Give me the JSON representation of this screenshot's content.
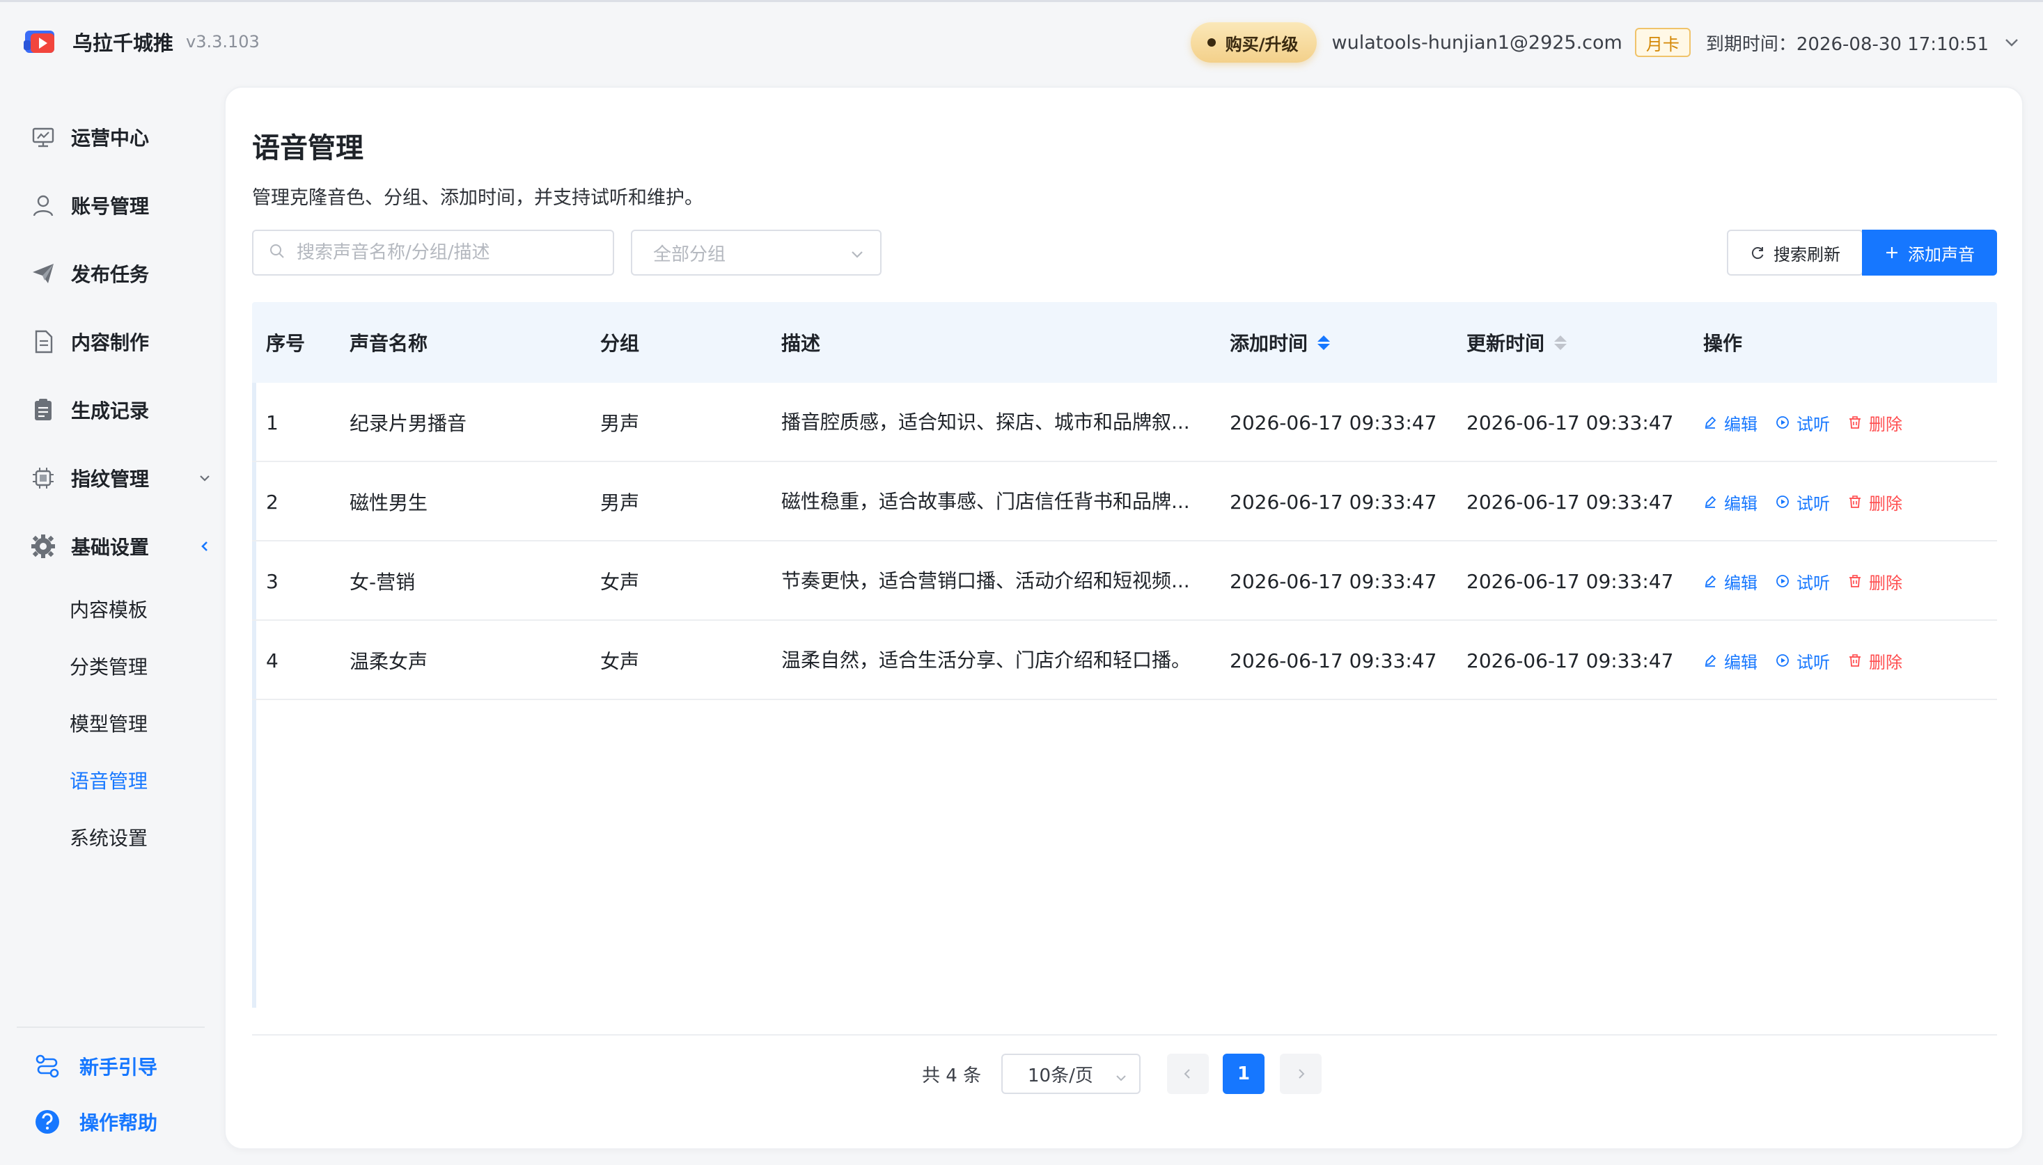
{
  "app": {
    "name": "乌拉千城推",
    "version": "v3.3.103"
  },
  "header": {
    "buy_label": "购买/升级",
    "email": "wulatools-hunjian1@2925.com",
    "plan_badge": "月卡",
    "expire_text": "到期时间：2026-08-30 17:10:51"
  },
  "sidebar": {
    "items": [
      {
        "label": "运营中心",
        "icon": "monitor-icon"
      },
      {
        "label": "账号管理",
        "icon": "user-icon"
      },
      {
        "label": "发布任务",
        "icon": "send-icon"
      },
      {
        "label": "内容制作",
        "icon": "document-icon"
      },
      {
        "label": "生成记录",
        "icon": "clipboard-icon"
      },
      {
        "label": "指纹管理",
        "icon": "chip-icon"
      },
      {
        "label": "基础设置",
        "icon": "gear-icon"
      }
    ],
    "sub_items": [
      {
        "label": "内容模板"
      },
      {
        "label": "分类管理"
      },
      {
        "label": "模型管理"
      },
      {
        "label": "语音管理"
      },
      {
        "label": "系统设置"
      }
    ],
    "footer": [
      {
        "label": "新手引导",
        "icon": "route-icon"
      },
      {
        "label": "操作帮助",
        "icon": "help-icon"
      }
    ]
  },
  "page": {
    "title": "语音管理",
    "description": "管理克隆音色、分组、添加时间，并支持试听和维护。"
  },
  "toolbar": {
    "search_placeholder": "搜索声音名称/分组/描述",
    "group_select": "全部分组",
    "refresh_label": "搜索刷新",
    "add_label": "添加声音"
  },
  "table": {
    "columns": [
      "序号",
      "声音名称",
      "分组",
      "描述",
      "添加时间",
      "更新时间",
      "操作"
    ],
    "rows": [
      {
        "index": "1",
        "name": "纪录片男播音",
        "group": "男声",
        "desc": "播音腔质感，适合知识、探店、城市和品牌叙...",
        "created": "2026-06-17 09:33:47",
        "updated": "2026-06-17 09:33:47"
      },
      {
        "index": "2",
        "name": "磁性男生",
        "group": "男声",
        "desc": "磁性稳重，适合故事感、门店信任背书和品牌...",
        "created": "2026-06-17 09:33:47",
        "updated": "2026-06-17 09:33:47"
      },
      {
        "index": "3",
        "name": "女-营销",
        "group": "女声",
        "desc": "节奏更快，适合营销口播、活动介绍和短视频...",
        "created": "2026-06-17 09:33:47",
        "updated": "2026-06-17 09:33:47"
      },
      {
        "index": "4",
        "name": "温柔女声",
        "group": "女声",
        "desc": "温柔自然，适合生活分享、门店介绍和轻口播。",
        "created": "2026-06-17 09:33:47",
        "updated": "2026-06-17 09:33:47"
      }
    ],
    "actions": {
      "edit": "编辑",
      "play": "试听",
      "delete": "删除"
    }
  },
  "pagination": {
    "total": "共 4 条",
    "page_size": "10条/页",
    "current_page": "1"
  },
  "colors": {
    "primary": "#1677ff",
    "danger": "#ff4d4f",
    "gold": "#f3d08a"
  }
}
